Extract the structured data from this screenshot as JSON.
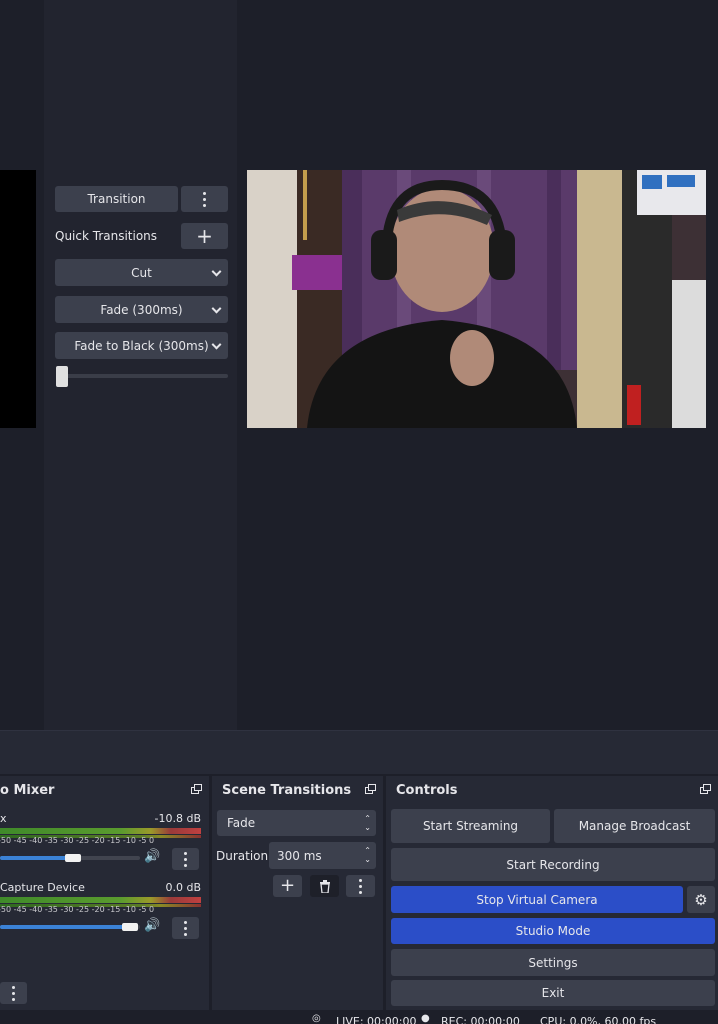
{
  "transitions_panel": {
    "transition_button": "Transition",
    "quick_transitions_label": "Quick Transitions",
    "quick_items": [
      "Cut",
      "Fade (300ms)",
      "Fade to Black (300ms)"
    ]
  },
  "mixer": {
    "title": "o Mixer",
    "channels": [
      {
        "name": "x",
        "db": "-10.8 dB",
        "volume": 0.8
      },
      {
        "name": "Capture Device",
        "db": "0.0 dB",
        "volume": 1.0
      }
    ],
    "tick_labels": "-50 -45 -40 -35 -30 -25 -20 -15 -10 -5 0"
  },
  "scene_transitions": {
    "title": "Scene Transitions",
    "selected": "Fade",
    "duration_label": "Duration",
    "duration_value": "300 ms"
  },
  "controls": {
    "title": "Controls",
    "start_streaming": "Start Streaming",
    "manage_broadcast": "Manage Broadcast",
    "start_recording": "Start Recording",
    "stop_virtual_camera": "Stop Virtual Camera",
    "studio_mode": "Studio Mode",
    "settings": "Settings",
    "exit": "Exit"
  },
  "status_bar": {
    "live": "LIVE: 00:00:00",
    "rec": "REC: 00:00:00",
    "cpu": "CPU: 0.0%, 60.00 fps"
  },
  "colors": {
    "accent": "#2b4ec8",
    "background": "#1d1f29",
    "button": "#3c404d"
  }
}
